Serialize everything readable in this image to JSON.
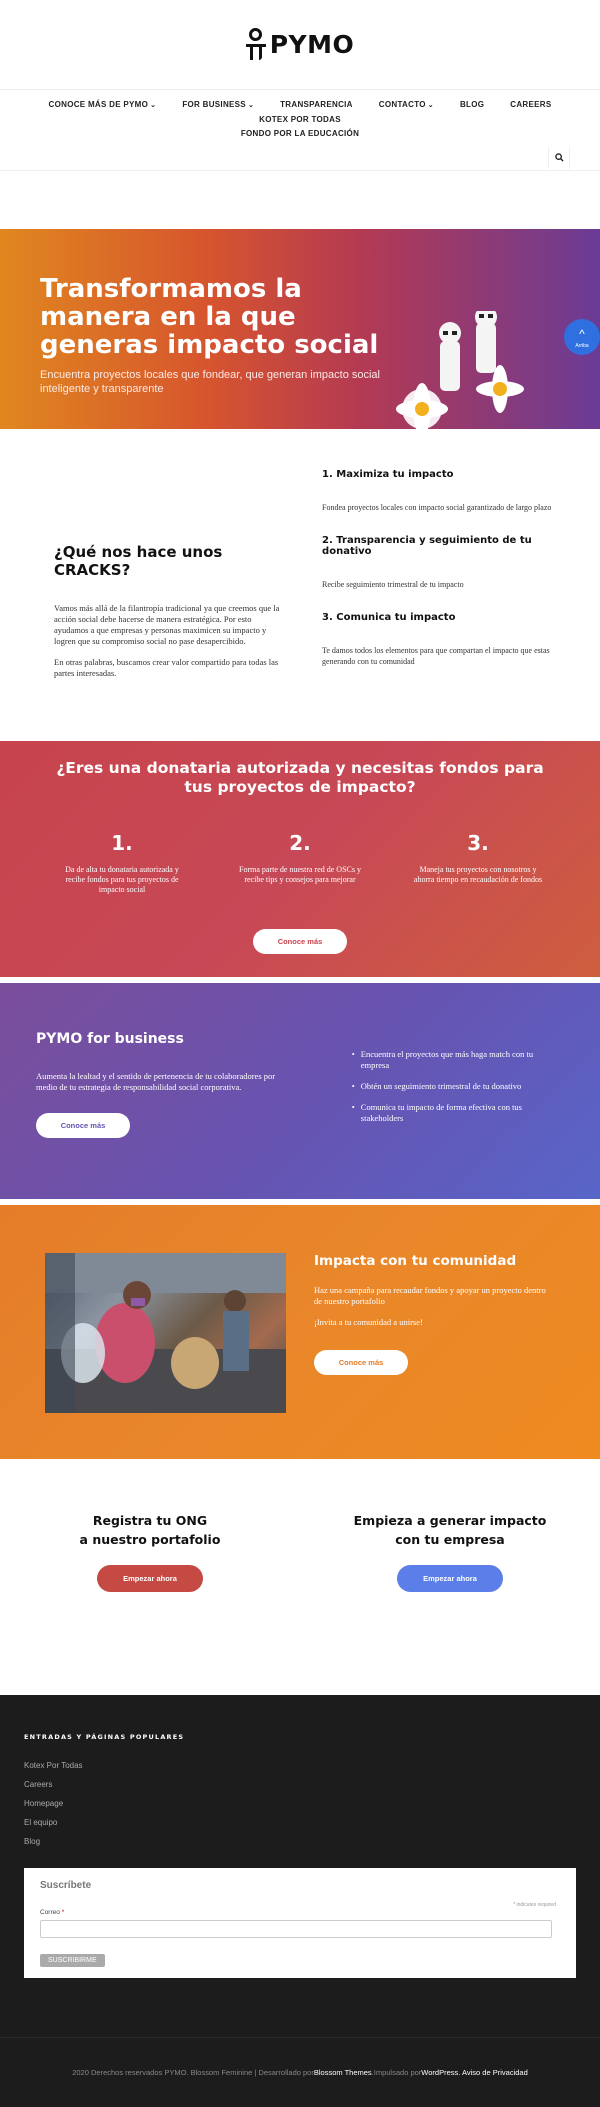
{
  "brand": {
    "name": "PYMO"
  },
  "nav": {
    "items": [
      {
        "label": "CONOCE MÁS DE PYMO",
        "dropdown": true
      },
      {
        "label": "FOR BUSINESS",
        "dropdown": true
      },
      {
        "label": "TRANSPARENCIA",
        "dropdown": false
      },
      {
        "label": "CONTACTO",
        "dropdown": true
      },
      {
        "label": "BLOG",
        "dropdown": false
      },
      {
        "label": "CAREERS",
        "dropdown": false
      },
      {
        "label": "KOTEX POR TODAS",
        "dropdown": false
      }
    ],
    "second_row": "FONDO POR LA EDUCACIÓN",
    "search_icon": "search-icon",
    "chevron": "⌄"
  },
  "hero": {
    "title": "Transformamos la manera en la que generas impacto social",
    "subtitle": "Encuentra proyectos locales que fondear, que generan impacto social inteligente y transparente",
    "scroll_top_label": "Arriba",
    "scroll_top_icon": "^"
  },
  "cracks": {
    "title": "¿Qué nos hace unos CRACKS?",
    "p1": "Vamos más allá de la filantropía tradicional ya que creemos que la acción social debe hacerse de manera estratégica. Por esto ayudamos a que empresas y personas maximicen su impacto y logren que su compromiso social no pase desapercibido.",
    "p2": "En otras palabras, buscamos crear valor compartido para todas las partes interesadas.",
    "features": [
      {
        "title": "1. Maximiza tu impacto",
        "text": "Fondea proyectos locales con impacto social garantizado de largo plazo"
      },
      {
        "title": "2. Transparencia y seguimiento de tu donativo",
        "text": "Recibe seguimiento trimestral de tu impacto"
      },
      {
        "title": "3. Comunica tu impacto",
        "text": "Te damos todos los elementos para que compartan el impacto que estas generando con tu comunidad"
      }
    ]
  },
  "donataria": {
    "title": "¿Eres una donataria autorizada y necesitas fondos para tus proyectos de impacto?",
    "steps": [
      {
        "num": "1.",
        "text": "Da de alta tu donataria autorizada y recibe fondos para tus proyectos de impacto social"
      },
      {
        "num": "2.",
        "text": "Forma parte de nuestra red de OSCs y recibe tips y consejos para mejorar"
      },
      {
        "num": "3.",
        "text": "Maneja tus proyectos con nosotros y ahorra tiempo en recaudación de fondos"
      }
    ],
    "button": "Conoce más"
  },
  "business": {
    "title": "PYMO for business",
    "text": "Aumenta la lealtad y el sentido de pertenencia de tu colaboradores por medio de tu estrategia de responsabilidad social corporativa.",
    "button": "Conoce más",
    "bullets": [
      "Encuentra el proyectos que más haga match con tu empresa",
      "Obtén un seguimiento trimestral de tu donativo",
      "Comunica tu impacto de forma efectiva con tus stakeholders"
    ]
  },
  "comunidad": {
    "title": "Impacta con tu comunidad",
    "p1": "Haz una campaña para recaudar fondos y apoyar un proyecto dentro de nuestro portafolio",
    "p2": "¡Invita a tu comunidad a unirse!",
    "button": "Conoce más"
  },
  "cta": {
    "ong_line1": "Registra tu ONG",
    "ong_line2": "a nuestro portafolio",
    "ong_button": "Empezar ahora",
    "emp_line1": "Empieza a generar impacto",
    "emp_line2": "con tu empresa",
    "emp_button": "Empezar ahora"
  },
  "footer": {
    "heading": "ENTRADAS Y PÁGINAS POPULARES",
    "links": [
      "Kotex Por Todas",
      "Careers",
      "Homepage",
      "El equipo",
      "Blog"
    ],
    "subscribe": {
      "title": "Suscríbete",
      "required_note": "* indicates required",
      "label": "Correo",
      "required_mark": "*",
      "input_value": "",
      "button": "SUSCRIBIRME"
    },
    "bottom": {
      "copyright": "2020 Derechos reservados PYMO. Blossom Feminine | Desarrollado por ",
      "themes": "Blossom Themes",
      "powered": ".Impulsado por ",
      "wordpress": "WordPress",
      "privacy": ". Aviso de Privacidad"
    }
  },
  "colors": {
    "donataria": "#c7444c",
    "business": "#6654b2",
    "comunidad": "#e57c29",
    "ong_button": "#c44a43",
    "emp_button": "#5b7ee8",
    "footer_bg": "#1c1c1c"
  }
}
